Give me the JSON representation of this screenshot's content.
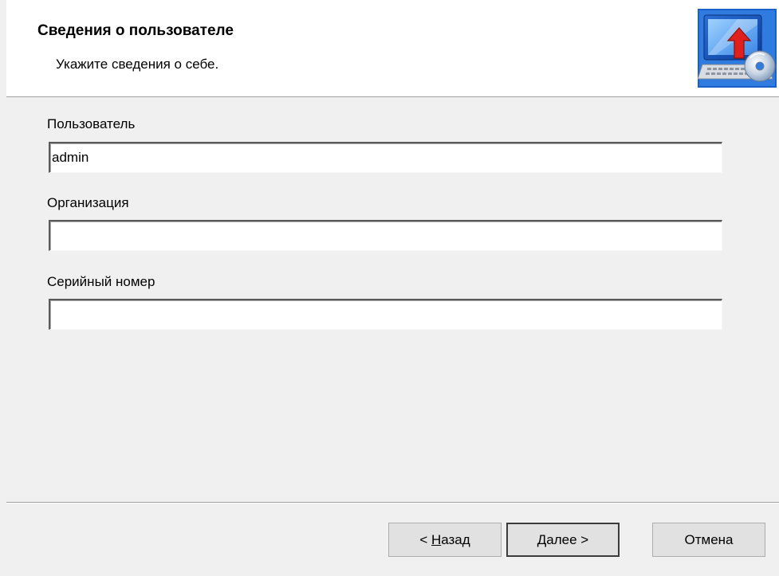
{
  "header": {
    "title": "Сведения о пользователе",
    "subtitle": "Укажите сведения о себе.",
    "icon": "setup-computer-icon"
  },
  "form": {
    "user_label": "Пользователь",
    "user_value": "admin",
    "organization_label": "Организация",
    "organization_value": "",
    "serial_label": "Серийный номер",
    "serial_value": ""
  },
  "buttons": {
    "back_prefix": "< ",
    "back_mnemonic": "Н",
    "back_rest": "азад",
    "next_mnemonic": "Д",
    "next_rest": "алее >",
    "cancel_label": "Отмена"
  },
  "colors": {
    "header_bg": "#ffffff",
    "body_bg": "#f0f0f0",
    "button_bg": "#e1e1e1"
  }
}
